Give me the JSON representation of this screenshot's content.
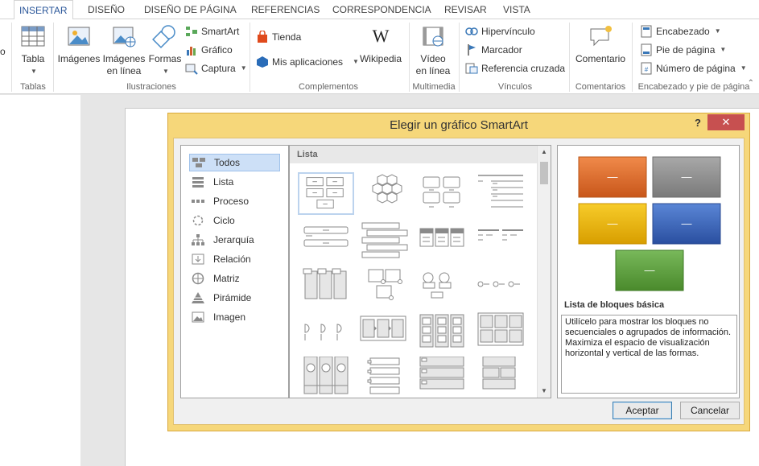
{
  "ribbon": {
    "tabs": [
      "INSERTAR",
      "DISEÑO",
      "DISEÑO DE PÁGINA",
      "REFERENCIAS",
      "CORRESPONDENCIA",
      "REVISAR",
      "VISTA"
    ],
    "active_tab": "INSERTAR",
    "left_fragment": "o",
    "groups": {
      "tablas": {
        "label": "Tablas",
        "tabla": "Tabla"
      },
      "ilustraciones": {
        "label": "Ilustraciones",
        "imagenes": "Imágenes",
        "imagenes_linea_1": "Imágenes",
        "imagenes_linea_2": "en línea",
        "formas": "Formas",
        "smartart": "SmartArt",
        "grafico": "Gráfico",
        "captura": "Captura"
      },
      "complementos": {
        "label": "Complementos",
        "tienda": "Tienda",
        "mis_aplicaciones": "Mis aplicaciones",
        "wikipedia": "Wikipedia"
      },
      "multimedia": {
        "label": "Multimedia",
        "video_1": "Vídeo",
        "video_2": "en línea"
      },
      "vinculos": {
        "label": "Vínculos",
        "hipervinculo": "Hipervínculo",
        "marcador": "Marcador",
        "referencia": "Referencia cruzada"
      },
      "comentarios": {
        "label": "Comentarios",
        "comentario": "Comentario"
      },
      "encabezado": {
        "label": "Encabezado y pie de página",
        "encabezado": "Encabezado",
        "pie": "Pie de página",
        "numero": "Número de página"
      }
    }
  },
  "dialog": {
    "title": "Elegir un gráfico SmartArt",
    "help": "?",
    "close": "✕",
    "categories": [
      "Todos",
      "Lista",
      "Proceso",
      "Ciclo",
      "Jerarquía",
      "Relación",
      "Matriz",
      "Pirámide",
      "Imagen"
    ],
    "selected_category": "Todos",
    "gallery_header": "Lista",
    "preview_title": "Lista de bloques básica",
    "preview_description": "Utilícelo para mostrar los bloques no secuenciales o agrupados de información. Maximiza el espacio de visualización horizontal y vertical de las formas.",
    "preview_block_labels": [
      "—",
      "—",
      "—",
      "—",
      "—"
    ],
    "accept": "Aceptar",
    "cancel": "Cancelar",
    "colors": {
      "orange": "#e06a1c",
      "gray": "#8c8c8c",
      "gold": "#e8b40c",
      "blue": "#3a63b5",
      "green": "#5a9a3a"
    }
  }
}
